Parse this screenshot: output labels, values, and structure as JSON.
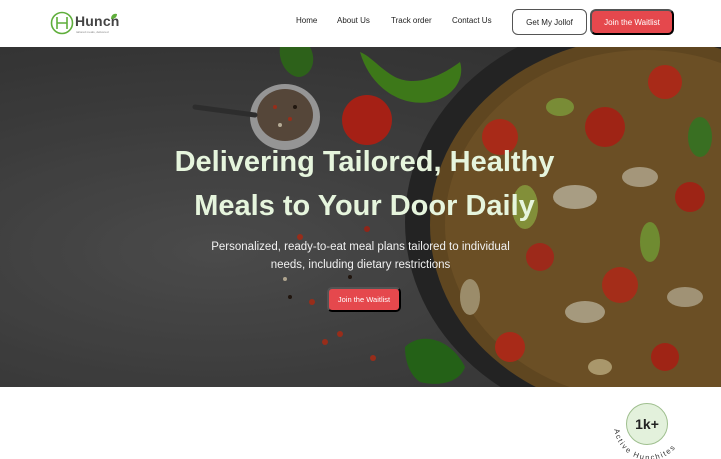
{
  "brand": {
    "name": "Hunch",
    "tagline": "tailored meals, delivered",
    "accent_color": "#e5484d",
    "logo_green": "#5fae3b"
  },
  "nav": {
    "links": [
      {
        "label": "Home"
      },
      {
        "label": "About Us"
      },
      {
        "label": "Track order"
      },
      {
        "label": "Contact Us"
      }
    ],
    "get_label": "Get My Jollof",
    "waitlist_label": "Join the Waitlist"
  },
  "hero": {
    "title_line1": "Delivering Tailored, Healthy",
    "title_line2": "Meals to Your Door Daily",
    "subtitle_line1": "Personalized, ready-to-eat meal plans tailored to individual",
    "subtitle_line2": "needs, including dietary restrictions",
    "cta_label": "Join the Waitlist",
    "title_color": "#e6f5dd"
  },
  "stats": {
    "count": "1k+",
    "caption": "Active Hunchites"
  }
}
